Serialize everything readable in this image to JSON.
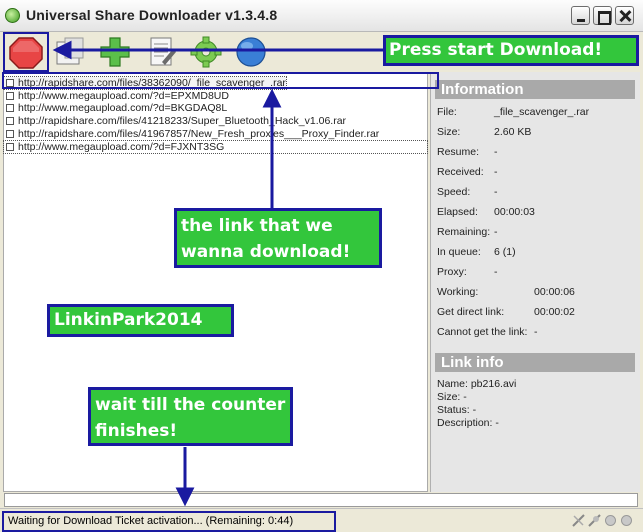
{
  "window": {
    "title": "Universal Share Downloader v1.3.4.8"
  },
  "toolbar": {
    "buttons": [
      {
        "name": "start",
        "icon": "stop-sign-icon"
      },
      {
        "name": "window",
        "icon": "window-icon"
      },
      {
        "name": "add",
        "icon": "plus-icon"
      },
      {
        "name": "edit",
        "icon": "document-icon"
      },
      {
        "name": "settings",
        "icon": "gear-icon"
      },
      {
        "name": "help",
        "icon": "globe-icon"
      }
    ]
  },
  "links": [
    {
      "url": "http://rapidshare.com/files/38362090/_file_scavenger_.rar",
      "selected": true
    },
    {
      "url": "http://www.megaupload.com/?d=EPXMD8UD",
      "selected": false
    },
    {
      "url": "http://www.megaupload.com/?d=BKGDAQ8L",
      "selected": false
    },
    {
      "url": "http://rapidshare.com/files/41218233/Super_Bluetooth_Hack_v1.06.rar",
      "selected": false
    },
    {
      "url": "http://rapidshare.com/files/41967857/New_Fresh_proxies___Proxy_Finder.rar",
      "selected": false
    },
    {
      "url": "http://www.megaupload.com/?d=FJXNT3SG",
      "selected": false
    }
  ],
  "information": {
    "heading": "Information",
    "file_label": "File:",
    "file_value": "_file_scavenger_.rar",
    "size_label": "Size:",
    "size_value": "2.60 KB",
    "resume_label": "Resume:",
    "resume_value": "-",
    "received_label": "Received:",
    "received_value": "-",
    "speed_label": "Speed:",
    "speed_value": "-",
    "elapsed_label": "Elapsed:",
    "elapsed_value": "00:00:03",
    "remaining_label": "Remaining:",
    "remaining_value": "-",
    "queue_label": "In queue:",
    "queue_value": "6 (1)",
    "proxy_label": "Proxy:",
    "proxy_value": "-",
    "working_label": "Working:",
    "working_value": "00:00:06",
    "direct_label": "Get direct link:",
    "direct_value": "00:00:02",
    "cannot_label": "Cannot get the link:",
    "cannot_value": "-"
  },
  "link_info": {
    "heading": "Link info",
    "name": "Name: pb216.avi",
    "size": "Size: -",
    "status": "Status: -",
    "description": "Description: -"
  },
  "status": {
    "text": "Waiting for Download Ticket activation... (Remaining: 0:44)"
  },
  "annotations": {
    "start": "Press start Download!",
    "link": "the link that we wanna download!",
    "user": "LinkinPark2014",
    "wait": "wait till the counter finishes!"
  },
  "colors": {
    "note_fill": "#33c63c",
    "note_border": "#1a1aa0",
    "panel_header": "#a9a9a9"
  }
}
